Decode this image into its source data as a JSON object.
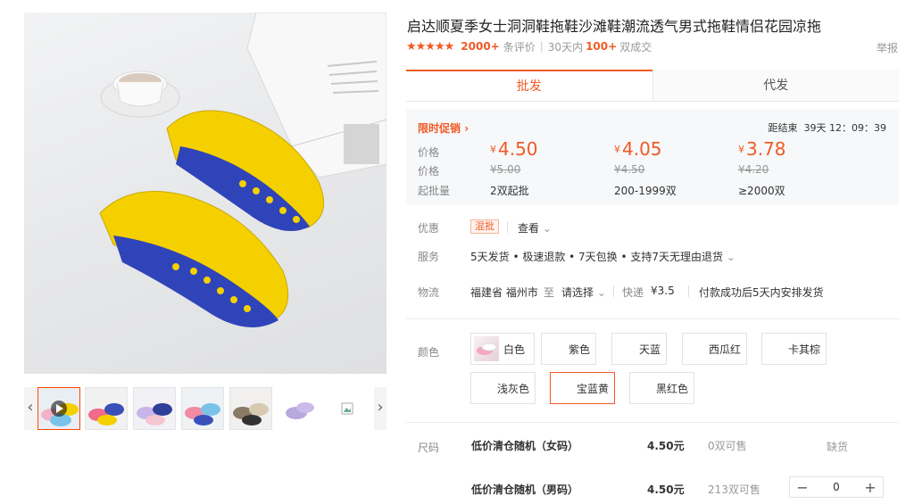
{
  "product": {
    "title": "启达顺夏季女士洞洞鞋拖鞋沙滩鞋潮流透气男式拖鞋情侣花园凉拖",
    "stars": "★★★★★",
    "review_count": "2000+",
    "review_suffix": "条评价",
    "sales_prefix": "30天内",
    "sales_count": "100+",
    "sales_suffix": "双成交",
    "report_label": "举报"
  },
  "tabs": [
    {
      "label": "批发",
      "active": true
    },
    {
      "label": "代发",
      "active": false
    }
  ],
  "pricing": {
    "promo_label": "限时促销",
    "countdown_label": "距结束",
    "countdown_value": "39天 12：09：39",
    "price_label": "价格",
    "original_label": "价格",
    "moq_label": "起批量",
    "currency": "¥",
    "tiers": [
      {
        "price": "4.50",
        "original": "¥5.00",
        "quantity": "2双起批"
      },
      {
        "price": "4.05",
        "original": "¥4.50",
        "quantity": "200-1999双"
      },
      {
        "price": "3.78",
        "original": "¥4.20",
        "quantity": "≥2000双"
      }
    ]
  },
  "discount": {
    "label": "优惠",
    "tag": "混批",
    "view_label": "查看"
  },
  "service": {
    "label": "服务",
    "text": "5天发货 • 极速退款 • 7天包换 • 支持7天无理由退货"
  },
  "logistics": {
    "label": "物流",
    "origin": "福建省 福州市",
    "to": "至",
    "destination": "请选择",
    "express_label": "快递",
    "express_price": "¥3.5",
    "shipping_note": "付款成功后5天内安排发货"
  },
  "colors": {
    "label": "颜色",
    "options": [
      {
        "name": "白色",
        "selected": false
      },
      {
        "name": "紫色",
        "selected": false
      },
      {
        "name": "天蓝",
        "selected": false
      },
      {
        "name": "西瓜红",
        "selected": false
      },
      {
        "name": "卡其棕",
        "selected": false
      },
      {
        "name": "浅灰色",
        "selected": false
      },
      {
        "name": "宝蓝黄",
        "selected": true
      },
      {
        "name": "黑红色",
        "selected": false
      }
    ]
  },
  "sizes": {
    "label": "尺码",
    "rows": [
      {
        "name": "低价清仓随机（女码）",
        "price": "4.50元",
        "stock": "0双可售",
        "status": "缺货"
      },
      {
        "name": "低价清仓随机（男码）",
        "price": "4.50元",
        "stock": "213双可售",
        "quantity": "0"
      }
    ]
  },
  "icons": {
    "prev": "chevron-left-icon",
    "next": "chevron-right-icon",
    "play": "play-icon",
    "dropdown": "chevron-down-icon",
    "broken_image": "broken-image-icon"
  },
  "colors_theme": {
    "accent": "#f05a24",
    "price_bg": "#f6f8fa"
  }
}
